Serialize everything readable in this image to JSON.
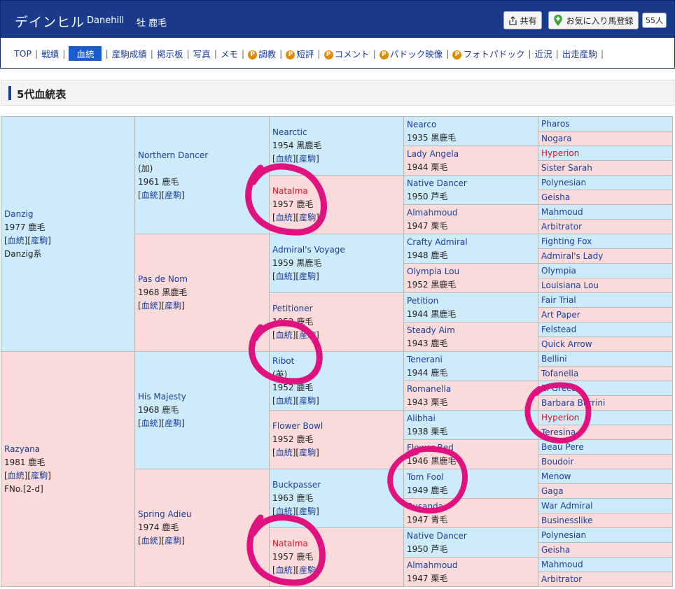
{
  "header": {
    "horse_name": "デインヒル",
    "horse_name_en": "Danehill",
    "sex_color": "牡 鹿毛",
    "share_label": "共有",
    "favorite_label": "お気に入り馬登録",
    "favorite_count": "55人"
  },
  "nav": [
    {
      "label": "TOP"
    },
    {
      "label": "戦績"
    },
    {
      "label": "血統",
      "active": true
    },
    {
      "label": "産駒成績"
    },
    {
      "label": "掲示板"
    },
    {
      "label": "写真"
    },
    {
      "label": "メモ"
    },
    {
      "label": "調教",
      "premium": true
    },
    {
      "label": "短評",
      "premium": true
    },
    {
      "label": "コメント",
      "premium": true
    },
    {
      "label": "パドック映像",
      "premium": true
    },
    {
      "label": "フォトパドック",
      "premium": true
    },
    {
      "label": "近況"
    },
    {
      "label": "出走産駒"
    }
  ],
  "section_title": "5代血統表",
  "link_labels": {
    "pedigree": "血統",
    "progeny": "産駒"
  },
  "pedigree": {
    "gen1": [
      {
        "name": "Danzig",
        "year_color": "1977 鹿毛",
        "links": true,
        "extra": "Danzig系",
        "sex": "m"
      },
      {
        "name": "Razyana",
        "year_color": "1981 鹿毛",
        "links": true,
        "extra": "FNo.[2-d]",
        "sex": "f"
      }
    ],
    "gen2": [
      {
        "name": "Northern Dancer",
        "country": "(加)",
        "year_color": "1961 鹿毛",
        "links": true,
        "sex": "m"
      },
      {
        "name": "Pas de Nom",
        "year_color": "1968 黒鹿毛",
        "links": true,
        "sex": "f"
      },
      {
        "name": "His Majesty",
        "year_color": "1968 鹿毛",
        "links": true,
        "sex": "m"
      },
      {
        "name": "Spring Adieu",
        "year_color": "1974 鹿毛",
        "links": true,
        "sex": "f"
      }
    ],
    "gen3": [
      {
        "name": "Nearctic",
        "year_color": "1954 黒鹿毛",
        "links": true,
        "sex": "m"
      },
      {
        "name": "Natalma",
        "year_color": "1957 鹿毛",
        "links": true,
        "sex": "f",
        "highlight": true
      },
      {
        "name": "Admiral's Voyage",
        "year_color": "1959 黒鹿毛",
        "links": true,
        "sex": "m"
      },
      {
        "name": "Petitioner",
        "year_color": "1952 鹿毛",
        "links": true,
        "sex": "f"
      },
      {
        "name": "Ribot",
        "country": "(英)",
        "year_color": "1952 鹿毛",
        "links": true,
        "sex": "m"
      },
      {
        "name": "Flower Bowl",
        "year_color": "1952 鹿毛",
        "links": true,
        "sex": "f"
      },
      {
        "name": "Buckpasser",
        "year_color": "1963 鹿毛",
        "links": true,
        "sex": "m"
      },
      {
        "name": "Natalma",
        "year_color": "1957 鹿毛",
        "links": true,
        "sex": "f",
        "highlight": true
      }
    ],
    "gen4": [
      {
        "name": "Nearco",
        "year_color": "1935 黒鹿毛",
        "sex": "m"
      },
      {
        "name": "Lady Angela",
        "year_color": "1944 栗毛",
        "sex": "f"
      },
      {
        "name": "Native Dancer",
        "year_color": "1950 芦毛",
        "sex": "m"
      },
      {
        "name": "Almahmoud",
        "year_color": "1947 栗毛",
        "sex": "f"
      },
      {
        "name": "Crafty Admiral",
        "year_color": "1948 鹿毛",
        "sex": "m"
      },
      {
        "name": "Olympia Lou",
        "year_color": "1952 黒鹿毛",
        "sex": "f"
      },
      {
        "name": "Petition",
        "year_color": "1944 黒鹿毛",
        "sex": "m"
      },
      {
        "name": "Steady Aim",
        "year_color": "1943 鹿毛",
        "sex": "f"
      },
      {
        "name": "Tenerani",
        "year_color": "1944 鹿毛",
        "sex": "m"
      },
      {
        "name": "Romanella",
        "year_color": "1943 栗毛",
        "sex": "f"
      },
      {
        "name": "Alibhai",
        "year_color": "1938 栗毛",
        "sex": "m"
      },
      {
        "name": "Flower Bed",
        "year_color": "1946 黒鹿毛",
        "sex": "f"
      },
      {
        "name": "Tom Fool",
        "year_color": "1949 鹿毛",
        "sex": "m"
      },
      {
        "name": "Busanda",
        "year_color": "1947 青毛",
        "sex": "f"
      },
      {
        "name": "Native Dancer",
        "year_color": "1950 芦毛",
        "sex": "m"
      },
      {
        "name": "Almahmoud",
        "year_color": "1947 栗毛",
        "sex": "f"
      }
    ],
    "gen5": [
      {
        "name": "Pharos",
        "sex": "m"
      },
      {
        "name": "Nogara",
        "sex": "f"
      },
      {
        "name": "Hyperion",
        "sex": "m",
        "highlight": true
      },
      {
        "name": "Sister Sarah",
        "sex": "f"
      },
      {
        "name": "Polynesian",
        "sex": "m"
      },
      {
        "name": "Geisha",
        "sex": "f"
      },
      {
        "name": "Mahmoud",
        "sex": "m"
      },
      {
        "name": "Arbitrator",
        "sex": "f"
      },
      {
        "name": "Fighting Fox",
        "sex": "m"
      },
      {
        "name": "Admiral's Lady",
        "sex": "f"
      },
      {
        "name": "Olympia",
        "sex": "m"
      },
      {
        "name": "Louisiana Lou",
        "sex": "f"
      },
      {
        "name": "Fair Trial",
        "sex": "m"
      },
      {
        "name": "Art Paper",
        "sex": "f"
      },
      {
        "name": "Felstead",
        "sex": "m"
      },
      {
        "name": "Quick Arrow",
        "sex": "f"
      },
      {
        "name": "Bellini",
        "sex": "m"
      },
      {
        "name": "Tofanella",
        "sex": "f"
      },
      {
        "name": "El Greco",
        "sex": "m"
      },
      {
        "name": "Barbara Burrini",
        "sex": "f"
      },
      {
        "name": "Hyperion",
        "sex": "m",
        "highlight": true
      },
      {
        "name": "Teresina",
        "sex": "f"
      },
      {
        "name": "Beau Pere",
        "sex": "m"
      },
      {
        "name": "Boudoir",
        "sex": "f"
      },
      {
        "name": "Menow",
        "sex": "m"
      },
      {
        "name": "Gaga",
        "sex": "f"
      },
      {
        "name": "War Admiral",
        "sex": "m"
      },
      {
        "name": "Businesslike",
        "sex": "f"
      },
      {
        "name": "Polynesian",
        "sex": "m"
      },
      {
        "name": "Geisha",
        "sex": "f"
      },
      {
        "name": "Mahmoud",
        "sex": "m"
      },
      {
        "name": "Arbitrator",
        "sex": "f"
      }
    ]
  },
  "colors": {
    "header_bg": "#1a3a8c",
    "sire_cell": "#cdebfa",
    "dam_cell": "#fbdada",
    "highlight_text": "#d7152c",
    "annotation_ring": "#e0127f"
  }
}
